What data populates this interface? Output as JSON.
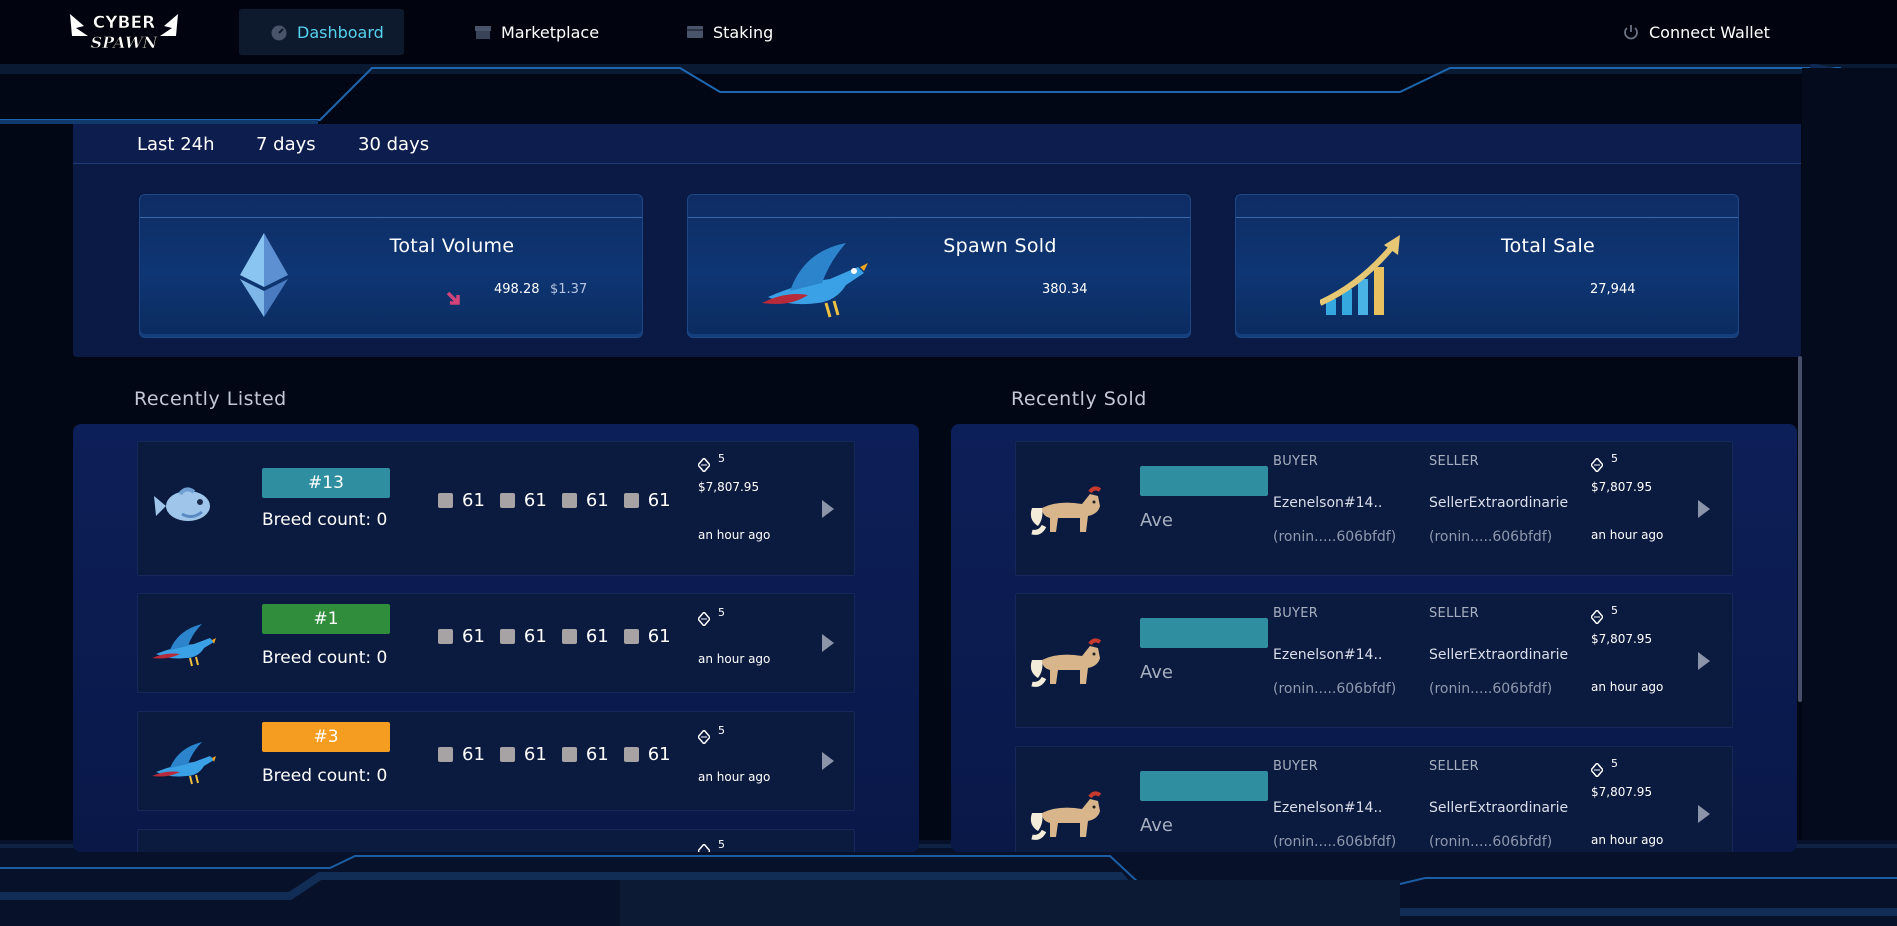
{
  "nav": {
    "logo_text": "CYBER SPAWN",
    "items": [
      {
        "label": "Dashboard",
        "icon": "dashboard-gauge-icon",
        "active": true
      },
      {
        "label": "Marketplace",
        "icon": "store-icon",
        "active": false
      },
      {
        "label": "Staking",
        "icon": "wallet-card-icon",
        "active": false
      }
    ],
    "connect_wallet": {
      "label": "Connect Wallet",
      "icon": "power-icon"
    }
  },
  "range_tabs": [
    "Last 24h",
    "7 days",
    "30 days"
  ],
  "stats": {
    "total_volume": {
      "title": "Total Volume",
      "value": "498.28",
      "usd": "$1.37",
      "icon": "ethereum-icon",
      "trend_icon": "down-arrow-icon"
    },
    "spawn_sold": {
      "title": "Spawn Sold",
      "value": "380.34",
      "icon": "blue-bird-icon"
    },
    "total_sale": {
      "title": "Total Sale",
      "value": "27,944",
      "icon": "growth-chart-icon"
    }
  },
  "recently_listed": {
    "title": "Recently Listed",
    "items": [
      {
        "id": "#13",
        "tag_color": "#2f8fa1",
        "breed_count": "Breed count: 0",
        "stats": [
          "61",
          "61",
          "61",
          "61"
        ],
        "qty": "5",
        "price": "$7,807.95",
        "time": "an hour ago",
        "avatar": "blue-fish-icon"
      },
      {
        "id": "#1",
        "tag_color": "#2f8d3c",
        "breed_count": "Breed count: 0",
        "stats": [
          "61",
          "61",
          "61",
          "61"
        ],
        "qty": "5",
        "price": "",
        "time": "an hour ago",
        "avatar": "blue-bird-icon"
      },
      {
        "id": "#3",
        "tag_color": "#f59d21",
        "breed_count": "Breed count: 0",
        "stats": [
          "61",
          "61",
          "61",
          "61"
        ],
        "qty": "5",
        "price": "",
        "time": "an hour ago",
        "avatar": "blue-bird-icon"
      },
      {
        "qty": "5"
      }
    ]
  },
  "recently_sold": {
    "title": "Recently Sold",
    "buyer_label": "BUYER",
    "seller_label": "SELLER",
    "items": [
      {
        "type": "Ave",
        "buyer": "Ezenelson#14..",
        "buyer_addr": "(ronin.....606bfdf)",
        "seller": "SellerExtraordinarie",
        "seller_addr": "(ronin.....606bfdf)",
        "qty": "5",
        "price": "$7,807.95",
        "time": "an hour ago",
        "avatar": "fox-creature-icon"
      },
      {
        "type": "Ave",
        "buyer": "Ezenelson#14..",
        "buyer_addr": "(ronin.....606bfdf)",
        "seller": "SellerExtraordinarie",
        "seller_addr": "(ronin.....606bfdf)",
        "qty": "5",
        "price": "$7,807.95",
        "time": "an hour ago",
        "avatar": "fox-creature-icon"
      },
      {
        "type": "Ave",
        "buyer": "Ezenelson#14..",
        "buyer_addr": "(ronin.....606bfdf)",
        "seller": "SellerExtraordinarie",
        "seller_addr": "(ronin.....606bfdf)",
        "qty": "5",
        "price": "$7,807.95",
        "time": "an hour ago",
        "avatar": "fox-creature-icon"
      }
    ]
  },
  "colors": {
    "accent": "#55d2ee",
    "panel": "#0b1a45",
    "tag_teal": "#2f8fa1"
  }
}
